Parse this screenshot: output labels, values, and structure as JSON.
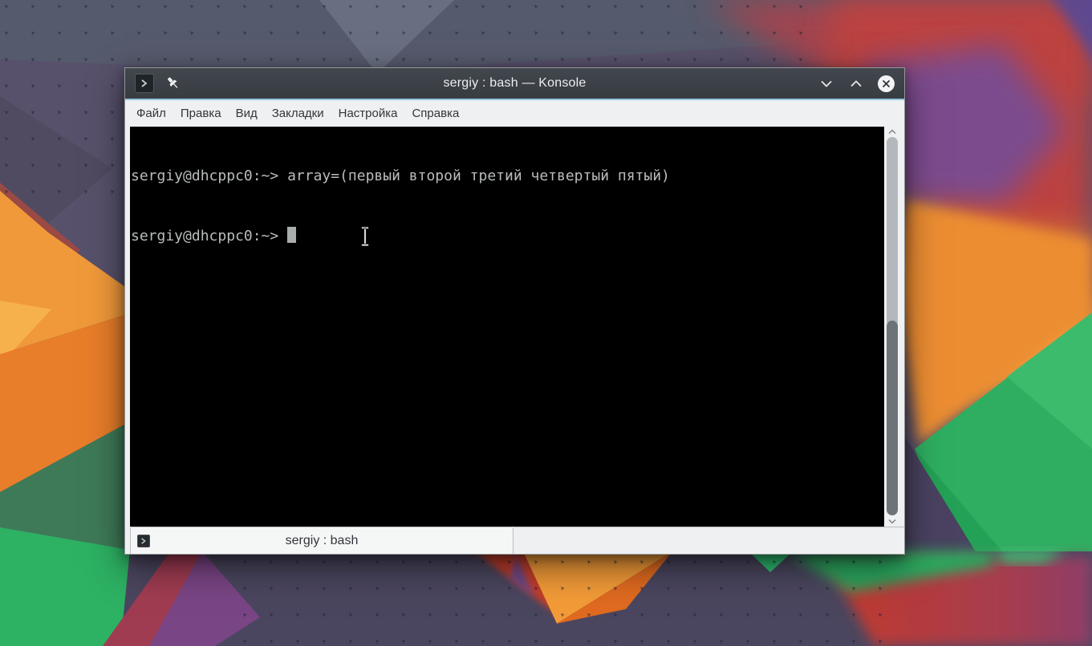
{
  "window": {
    "title": "sergiy : bash — Konsole",
    "menu": {
      "items": [
        "Файл",
        "Правка",
        "Вид",
        "Закладки",
        "Настройка",
        "Справка"
      ]
    },
    "controls": {
      "minimize": "chevron-down",
      "maximize": "chevron-up",
      "close": "x-in-circle"
    },
    "icons": {
      "titlebar_app": "konsole-terminal-icon",
      "pin": "pushpin-icon"
    }
  },
  "terminal": {
    "lines": [
      "sergiy@dhcppc0:~> array=(первый второй третий четвертый пятый)",
      "sergiy@dhcppc0:~>"
    ],
    "cursor_style": "block",
    "colors": {
      "background": "#000000",
      "foreground": "#b9bcbd",
      "cursor": "#a9adae"
    }
  },
  "scrollbar": {
    "thumb_position": "bottom-half",
    "colors": {
      "track": "#b4b8bc",
      "thumb": "#6e7377"
    }
  },
  "tabbar": {
    "tabs": [
      {
        "label": "sergiy : bash",
        "active": true,
        "icon": "terminal-icon"
      }
    ]
  },
  "theme": {
    "titlebar_bg": "#3c4146",
    "titlebar_fg": "#eceff0",
    "accent_line": "#95c4dd",
    "menubar_bg": "#eff0f1",
    "menubar_fg": "#31363b",
    "tab_bg": "#f5f6f6",
    "wallpaper_base": "#57516b",
    "wallpaper_orange": "#e87d2a",
    "wallpaper_green": "#2db163",
    "wallpaper_red": "#c23b2e",
    "wallpaper_purple": "#7b4b8d"
  }
}
